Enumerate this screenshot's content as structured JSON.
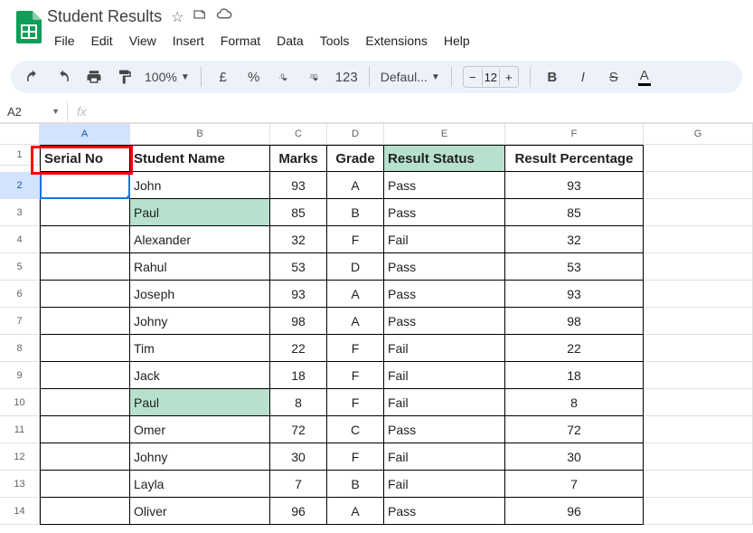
{
  "doc_title": "Student Results",
  "menus": [
    "File",
    "Edit",
    "View",
    "Insert",
    "Format",
    "Data",
    "Tools",
    "Extensions",
    "Help"
  ],
  "toolbar": {
    "zoom": "100%",
    "currency": "£",
    "percent": "%",
    "font": "Defaul...",
    "font_size": "12"
  },
  "name_box": "A2",
  "fx_label": "fx",
  "columns": [
    "A",
    "B",
    "C",
    "D",
    "E",
    "F",
    "G"
  ],
  "row_numbers": [
    "1",
    "2",
    "3",
    "4",
    "5",
    "6",
    "7",
    "8",
    "9",
    "10",
    "11",
    "12",
    "13",
    "14"
  ],
  "headers": {
    "a": "Serial No",
    "b": "Student  Name",
    "c": "Marks",
    "d": "Grade",
    "e": "Result Status",
    "f": "Result Percentage"
  },
  "rows": [
    {
      "name": "John",
      "marks": "93",
      "grade": "A",
      "status": "Pass",
      "pct": "93",
      "dup": false
    },
    {
      "name": "Paul",
      "marks": "85",
      "grade": "B",
      "status": "Pass",
      "pct": "85",
      "dup": true
    },
    {
      "name": "Alexander",
      "marks": "32",
      "grade": "F",
      "status": "Fail",
      "pct": "32",
      "dup": false
    },
    {
      "name": "Rahul",
      "marks": "53",
      "grade": "D",
      "status": "Pass",
      "pct": "53",
      "dup": false
    },
    {
      "name": "Joseph",
      "marks": "93",
      "grade": "A",
      "status": "Pass",
      "pct": "93",
      "dup": false
    },
    {
      "name": "Johny",
      "marks": "98",
      "grade": "A",
      "status": "Pass",
      "pct": "98",
      "dup": false
    },
    {
      "name": "Tim",
      "marks": "22",
      "grade": "F",
      "status": "Fail",
      "pct": "22",
      "dup": false
    },
    {
      "name": "Jack",
      "marks": "18",
      "grade": "F",
      "status": "Fail",
      "pct": "18",
      "dup": false
    },
    {
      "name": "Paul",
      "marks": "8",
      "grade": "F",
      "status": "Fail",
      "pct": "8",
      "dup": true
    },
    {
      "name": "Omer",
      "marks": "72",
      "grade": "C",
      "status": "Pass",
      "pct": "72",
      "dup": false
    },
    {
      "name": "Johny",
      "marks": "30",
      "grade": "F",
      "status": "Fail",
      "pct": "30",
      "dup": false
    },
    {
      "name": "Layla",
      "marks": "7",
      "grade": "B",
      "status": "Fail",
      "pct": "7",
      "dup": false
    },
    {
      "name": "Oliver",
      "marks": "96",
      "grade": "A",
      "status": "Pass",
      "pct": "96",
      "dup": false
    }
  ]
}
